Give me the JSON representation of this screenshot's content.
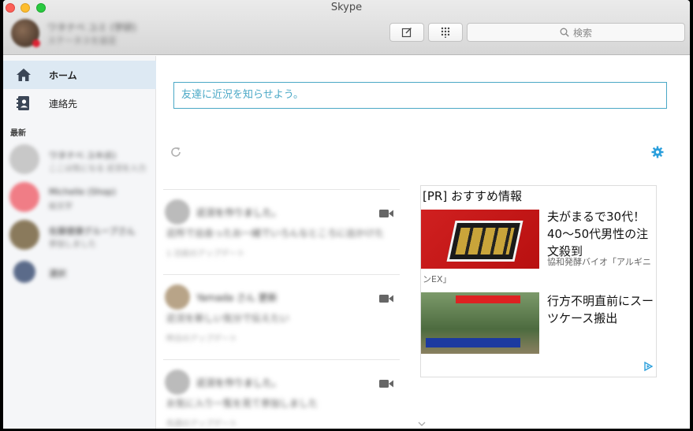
{
  "window": {
    "title": "Skype"
  },
  "profile": {
    "name": "ワタナベ ユミ (学研)",
    "status": "ステータスを設定"
  },
  "toolbar": {
    "compose_icon": "compose-icon",
    "dialpad_icon": "dialpad-icon"
  },
  "search": {
    "placeholder": "検索"
  },
  "sidebar": {
    "items": [
      {
        "label": "ホーム",
        "icon": "home-icon"
      },
      {
        "label": "連絡先",
        "icon": "contacts-icon"
      }
    ],
    "recent_label": "最新",
    "recent": [
      {
        "name": "ワタナベ ユキ(E)",
        "sub": "ここは気になる 近況を入力"
      },
      {
        "name": "Michelle (Shop)",
        "sub": "絵文字"
      },
      {
        "name": "佐藤健康グループさん",
        "sub": "参加しました"
      },
      {
        "name": "選択",
        "sub": ""
      }
    ]
  },
  "main": {
    "status_placeholder": "友達に近況を知らせよう。",
    "feed": [
      {
        "title": "近況を作りました。",
        "body": "近所で出会ったお一緒でいろんなところに出かけた",
        "time": "1 日前のアップデート"
      },
      {
        "title": "Yamada さん 更新",
        "body": "近況を新しい気分で伝えたい",
        "time": "昨日のアップデート"
      },
      {
        "title": "近況を作りました。",
        "body": "お気に入り一覧を見て参加しました",
        "time": "先週のアップデート"
      }
    ]
  },
  "ad": {
    "header": "[PR] おすすめ情報",
    "item1_title": "夫がまるで30代！40〜50代男性の注文殺到",
    "item1_advertiser": "協和発酵バイオ「アルギニ",
    "item1_advertiser_cont": "ンEX」",
    "item2_title": "行方不明直前にスーツケース搬出"
  },
  "colors": {
    "accent": "#4aa8c6",
    "sidebar_selected": "#dde9f3",
    "gear": "#2b9fdc"
  }
}
